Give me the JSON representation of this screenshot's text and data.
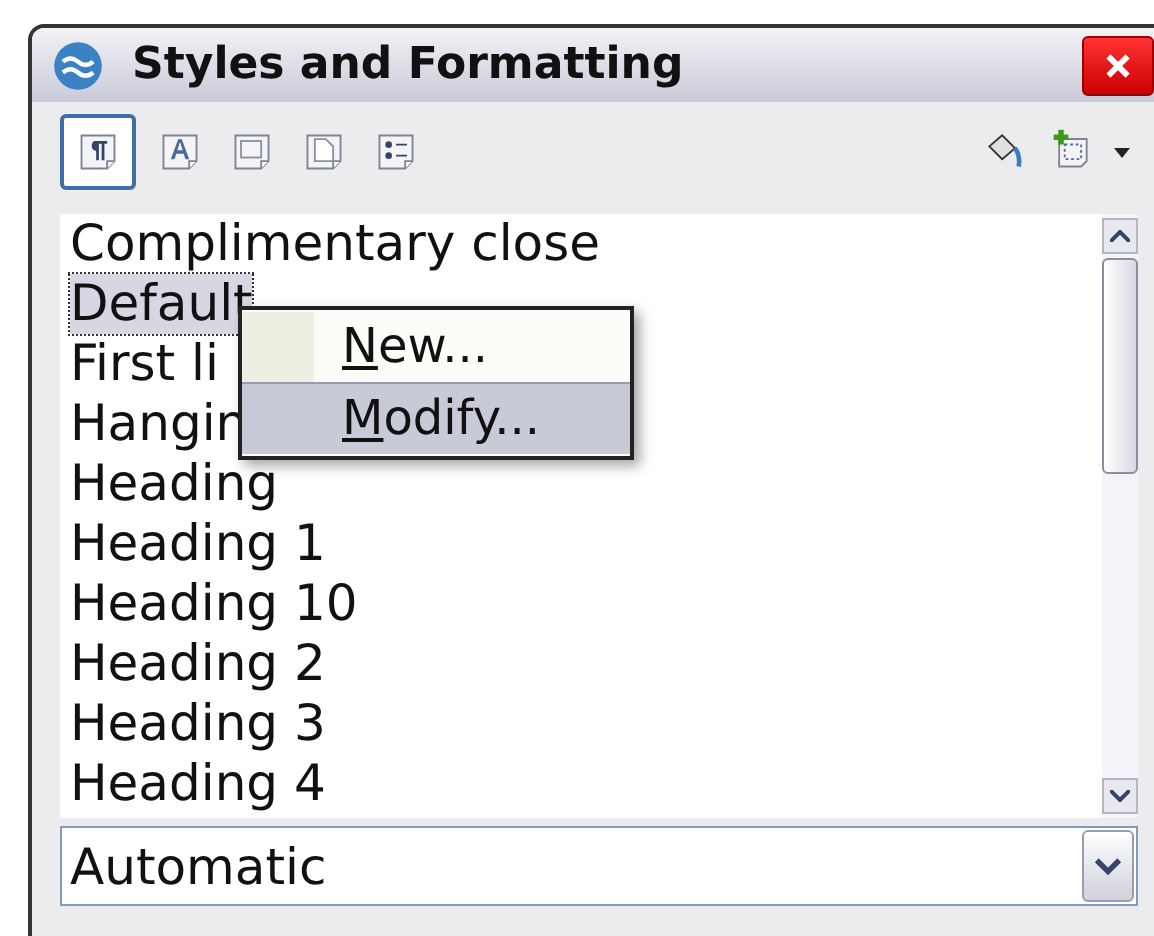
{
  "window": {
    "title": "Styles and Formatting"
  },
  "categories": [
    {
      "kind": "paragraph",
      "selected": true
    },
    {
      "kind": "character",
      "selected": false
    },
    {
      "kind": "frame",
      "selected": false
    },
    {
      "kind": "page",
      "selected": false
    },
    {
      "kind": "list",
      "selected": false
    }
  ],
  "styles": [
    {
      "label": "Complimentary close",
      "selected": false
    },
    {
      "label": "Default",
      "selected": true
    },
    {
      "label": "First li",
      "selected": false
    },
    {
      "label": "Hangin",
      "selected": false
    },
    {
      "label": "Heading",
      "selected": false
    },
    {
      "label": "Heading 1",
      "selected": false
    },
    {
      "label": "Heading 10",
      "selected": false
    },
    {
      "label": "Heading 2",
      "selected": false
    },
    {
      "label": "Heading 3",
      "selected": false
    },
    {
      "label": "Heading 4",
      "selected": false
    }
  ],
  "context_menu": [
    {
      "label": "New...",
      "selected": false
    },
    {
      "label": "Modify...",
      "selected": true
    }
  ],
  "filter": {
    "value": "Automatic"
  }
}
